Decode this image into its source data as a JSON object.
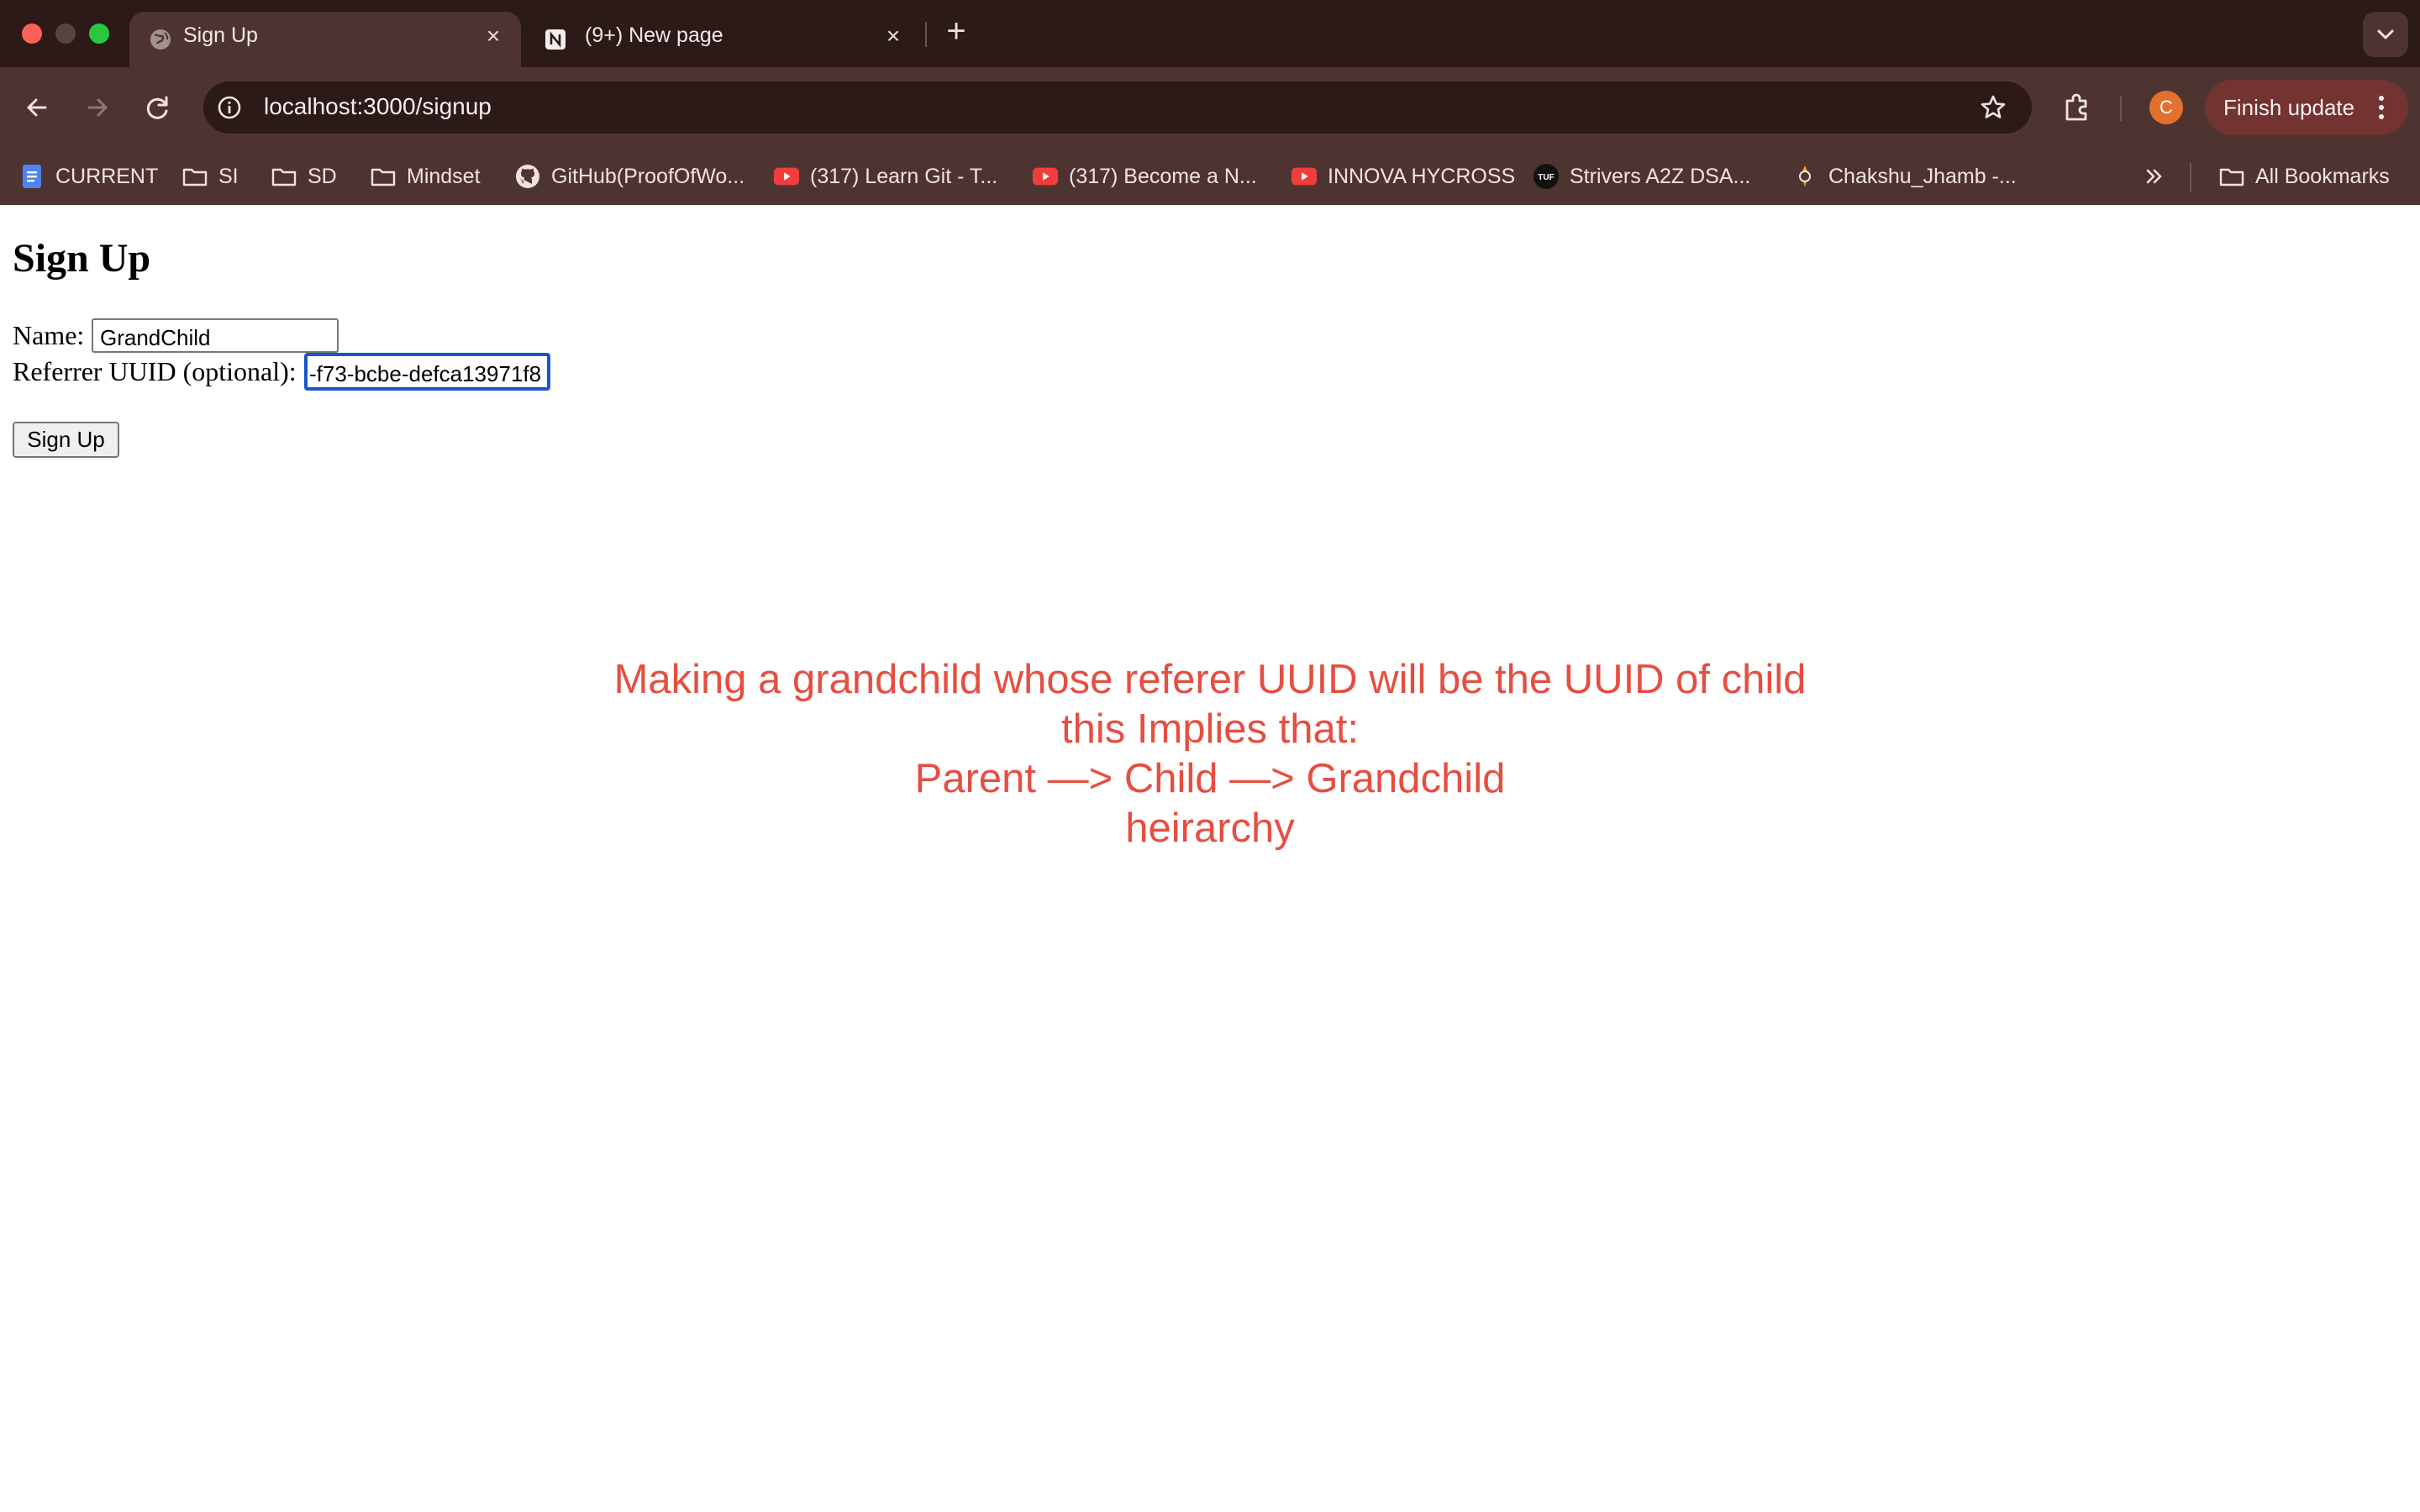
{
  "browser": {
    "tabs": [
      {
        "title": "Sign Up",
        "favicon": "globe-icon",
        "active": true
      },
      {
        "title": "(9+) New page",
        "favicon": "notion-icon",
        "active": false
      }
    ],
    "new_tab_icon": "plus-icon",
    "url": "localhost:3000/signup",
    "profile_initial": "C",
    "finish_update_label": "Finish update",
    "bookmarks": [
      {
        "label": "CURRENT",
        "icon": "docs-icon"
      },
      {
        "label": "SI",
        "icon": "folder-icon"
      },
      {
        "label": "SD",
        "icon": "folder-icon"
      },
      {
        "label": "Mindset",
        "icon": "folder-icon"
      },
      {
        "label": "GitHub(ProofOfWo...",
        "icon": "github-icon"
      },
      {
        "label": "(317) Learn Git - T...",
        "icon": "youtube-icon"
      },
      {
        "label": "(317) Become a N...",
        "icon": "youtube-icon"
      },
      {
        "label": "INNOVA HYCROSS",
        "icon": "youtube-icon"
      },
      {
        "label": "Strivers A2Z DSA...",
        "icon": "tuf-icon"
      },
      {
        "label": "Chakshu_Jhamb -...",
        "icon": "user-badge-icon"
      }
    ],
    "all_bookmarks_label": "All Bookmarks",
    "colors": {
      "tab_strip": "#2c1a18",
      "toolbar": "#4e3431",
      "finish_update": "#733330",
      "avatar": "#e3702e"
    }
  },
  "page": {
    "title": "Sign Up",
    "name_label": "Name:",
    "name_value": "GrandChild",
    "referrer_label": "Referrer UUID (optional):",
    "referrer_value": "-f73-bcbe-defca13971f8",
    "submit_label": "Sign Up",
    "annotation": {
      "lines": [
        "Making a grandchild whose referer UUID will be the UUID of child",
        "this Implies that:",
        "Parent —> Child —> Grandchild",
        "heirarchy"
      ],
      "color": "#e54f41"
    }
  }
}
